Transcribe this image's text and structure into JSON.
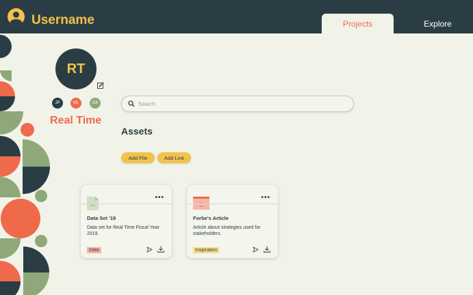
{
  "header": {
    "username": "Username",
    "tabs": [
      {
        "label": "Projects",
        "active": true
      },
      {
        "label": "Explore",
        "active": false
      }
    ]
  },
  "profile": {
    "initials": "RT",
    "name": "Real Time",
    "members": [
      "JP",
      "ML",
      "GK"
    ]
  },
  "search": {
    "placeholder": "Search"
  },
  "assets": {
    "title": "Assets",
    "add_file_label": "Add File",
    "add_link_label": "Add Link",
    "cards": [
      {
        "title": "Data Set '19",
        "description": "Data set for Real Time Fiscal Year 2019.",
        "tag": "Data",
        "thumb_label": "CSV"
      },
      {
        "title": "Forbe's Article",
        "description": "Article about strategies used for stakeholders.",
        "tag": "Inspiration",
        "thumb_label": "Link"
      }
    ]
  },
  "colors": {
    "navy": "#2b3d44",
    "yellow": "#f3c24a",
    "coral": "#ef6a4a",
    "sage": "#8fa87a",
    "background": "#f1f3e8"
  }
}
